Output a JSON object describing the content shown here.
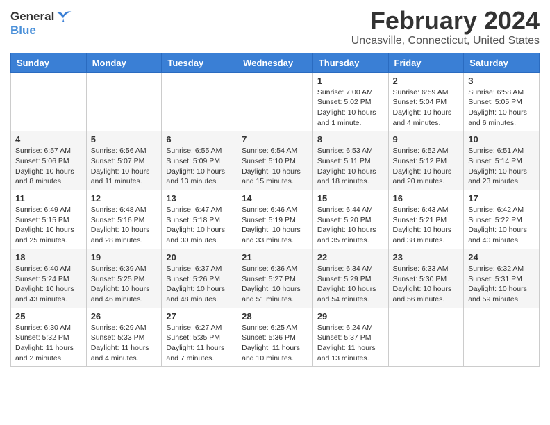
{
  "header": {
    "logo_general": "General",
    "logo_blue": "Blue",
    "title": "February 2024",
    "subtitle": "Uncasville, Connecticut, United States"
  },
  "calendar": {
    "days_of_week": [
      "Sunday",
      "Monday",
      "Tuesday",
      "Wednesday",
      "Thursday",
      "Friday",
      "Saturday"
    ],
    "weeks": [
      [
        {
          "day": "",
          "info": ""
        },
        {
          "day": "",
          "info": ""
        },
        {
          "day": "",
          "info": ""
        },
        {
          "day": "",
          "info": ""
        },
        {
          "day": "1",
          "info": "Sunrise: 7:00 AM\nSunset: 5:02 PM\nDaylight: 10 hours and 1 minute."
        },
        {
          "day": "2",
          "info": "Sunrise: 6:59 AM\nSunset: 5:04 PM\nDaylight: 10 hours and 4 minutes."
        },
        {
          "day": "3",
          "info": "Sunrise: 6:58 AM\nSunset: 5:05 PM\nDaylight: 10 hours and 6 minutes."
        }
      ],
      [
        {
          "day": "4",
          "info": "Sunrise: 6:57 AM\nSunset: 5:06 PM\nDaylight: 10 hours and 8 minutes."
        },
        {
          "day": "5",
          "info": "Sunrise: 6:56 AM\nSunset: 5:07 PM\nDaylight: 10 hours and 11 minutes."
        },
        {
          "day": "6",
          "info": "Sunrise: 6:55 AM\nSunset: 5:09 PM\nDaylight: 10 hours and 13 minutes."
        },
        {
          "day": "7",
          "info": "Sunrise: 6:54 AM\nSunset: 5:10 PM\nDaylight: 10 hours and 15 minutes."
        },
        {
          "day": "8",
          "info": "Sunrise: 6:53 AM\nSunset: 5:11 PM\nDaylight: 10 hours and 18 minutes."
        },
        {
          "day": "9",
          "info": "Sunrise: 6:52 AM\nSunset: 5:12 PM\nDaylight: 10 hours and 20 minutes."
        },
        {
          "day": "10",
          "info": "Sunrise: 6:51 AM\nSunset: 5:14 PM\nDaylight: 10 hours and 23 minutes."
        }
      ],
      [
        {
          "day": "11",
          "info": "Sunrise: 6:49 AM\nSunset: 5:15 PM\nDaylight: 10 hours and 25 minutes."
        },
        {
          "day": "12",
          "info": "Sunrise: 6:48 AM\nSunset: 5:16 PM\nDaylight: 10 hours and 28 minutes."
        },
        {
          "day": "13",
          "info": "Sunrise: 6:47 AM\nSunset: 5:18 PM\nDaylight: 10 hours and 30 minutes."
        },
        {
          "day": "14",
          "info": "Sunrise: 6:46 AM\nSunset: 5:19 PM\nDaylight: 10 hours and 33 minutes."
        },
        {
          "day": "15",
          "info": "Sunrise: 6:44 AM\nSunset: 5:20 PM\nDaylight: 10 hours and 35 minutes."
        },
        {
          "day": "16",
          "info": "Sunrise: 6:43 AM\nSunset: 5:21 PM\nDaylight: 10 hours and 38 minutes."
        },
        {
          "day": "17",
          "info": "Sunrise: 6:42 AM\nSunset: 5:22 PM\nDaylight: 10 hours and 40 minutes."
        }
      ],
      [
        {
          "day": "18",
          "info": "Sunrise: 6:40 AM\nSunset: 5:24 PM\nDaylight: 10 hours and 43 minutes."
        },
        {
          "day": "19",
          "info": "Sunrise: 6:39 AM\nSunset: 5:25 PM\nDaylight: 10 hours and 46 minutes."
        },
        {
          "day": "20",
          "info": "Sunrise: 6:37 AM\nSunset: 5:26 PM\nDaylight: 10 hours and 48 minutes."
        },
        {
          "day": "21",
          "info": "Sunrise: 6:36 AM\nSunset: 5:27 PM\nDaylight: 10 hours and 51 minutes."
        },
        {
          "day": "22",
          "info": "Sunrise: 6:34 AM\nSunset: 5:29 PM\nDaylight: 10 hours and 54 minutes."
        },
        {
          "day": "23",
          "info": "Sunrise: 6:33 AM\nSunset: 5:30 PM\nDaylight: 10 hours and 56 minutes."
        },
        {
          "day": "24",
          "info": "Sunrise: 6:32 AM\nSunset: 5:31 PM\nDaylight: 10 hours and 59 minutes."
        }
      ],
      [
        {
          "day": "25",
          "info": "Sunrise: 6:30 AM\nSunset: 5:32 PM\nDaylight: 11 hours and 2 minutes."
        },
        {
          "day": "26",
          "info": "Sunrise: 6:29 AM\nSunset: 5:33 PM\nDaylight: 11 hours and 4 minutes."
        },
        {
          "day": "27",
          "info": "Sunrise: 6:27 AM\nSunset: 5:35 PM\nDaylight: 11 hours and 7 minutes."
        },
        {
          "day": "28",
          "info": "Sunrise: 6:25 AM\nSunset: 5:36 PM\nDaylight: 11 hours and 10 minutes."
        },
        {
          "day": "29",
          "info": "Sunrise: 6:24 AM\nSunset: 5:37 PM\nDaylight: 11 hours and 13 minutes."
        },
        {
          "day": "",
          "info": ""
        },
        {
          "day": "",
          "info": ""
        }
      ]
    ]
  }
}
